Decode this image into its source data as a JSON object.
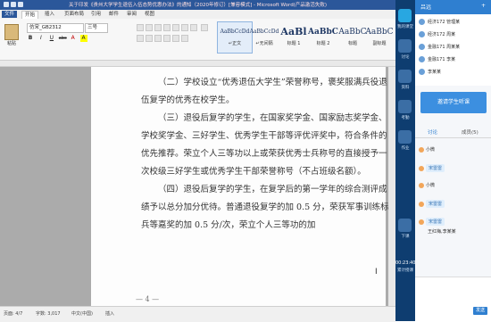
{
  "word": {
    "window_title": "关于印发《贵州大学学生退伍入伍态势优惠办法》的通知（2020年修订）[兼容模式] - Microsoft Word(产品激活失败)",
    "tabs": [
      "文件",
      "开始",
      "插入",
      "页面布局",
      "引用",
      "邮件",
      "审阅",
      "视图"
    ],
    "active_tab": "开始",
    "clipboard": {
      "paste_label": "粘贴"
    },
    "font": {
      "name": "仿宋_GB2312",
      "size": "三号"
    },
    "format_buttons": [
      "B",
      "I",
      "U",
      "abc",
      "A",
      "A"
    ],
    "styles": [
      {
        "sample": "AaBbCcDd",
        "name": "↵正文"
      },
      {
        "sample": "AaBbCcDd",
        "name": "↵无间隔"
      },
      {
        "sample": "AaBl",
        "name": "标题 1"
      },
      {
        "sample": "AaBbC",
        "name": "标题 2"
      },
      {
        "sample": "AaBbC",
        "name": "标题"
      },
      {
        "sample": "AaBbC",
        "name": "副标题"
      }
    ],
    "paragraphs": [
      "（二）学校设立“优秀退伍大学生”荣誉称号，褒奖服满兵役退伍复学的优秀在校学生。",
      "（三）退役后复学的学生，在国家奖学金、国家励志奖学金、学校奖学金、三好学生、优秀学生干部等评优评奖中，符合条件的优先推荐。荣立个人三等功以上或荣获优秀士兵称号的直接授予一次校级三好学生或优秀学生干部荣誉称号（不占班级名额）。",
      "（四）退役后复学的学生，在复学后的第一学年的综合测评成绩予以总分加分优待。普通退役复学的加 0.5 分，荣获军事训练标兵等嘉奖的加 0.5 分/次，荣立个人三等功的加"
    ],
    "page_number": "— 4 —",
    "status": {
      "page": "页面: 4/7",
      "words": "字数: 3,017",
      "lang": "中文(中国)",
      "mode": "插入"
    },
    "cursor_char": "I"
  },
  "dock": {
    "items": [
      {
        "label": "我的课堂",
        "color": "#28a7e1"
      },
      {
        "label": "讨论",
        "color": "#3b6ea5"
      },
      {
        "label": "资料",
        "color": "#3b6ea5"
      },
      {
        "label": "考勤",
        "color": "#3b6ea5"
      },
      {
        "label": "作业",
        "color": "#3b6ea5"
      },
      {
        "label": "下课",
        "color": "#3b6ea5"
      }
    ],
    "timer": "00:23:40",
    "timer_label": "累计授课"
  },
  "side": {
    "header_name": "吕远",
    "header_action": "+",
    "users": [
      "经济172 管理某",
      "经济172 周某",
      "金融171 周某某",
      "金融171 李某",
      "李某某"
    ],
    "invite_button": "邀请学生听课",
    "tabs": [
      "讨论",
      "成员(5)"
    ],
    "active_tab": "讨论",
    "messages": [
      {
        "sender": "小微",
        "text": ""
      },
      {
        "sender": "宋雷雷",
        "text": ""
      },
      {
        "sender": "小微",
        "text": ""
      },
      {
        "sender": "宋雷雷",
        "text": ""
      },
      {
        "sender": "宋雷雷",
        "text": "王红梅,李某某"
      }
    ],
    "send_button": "发送"
  },
  "colors": {
    "word_blue": "#2b579a",
    "dock_blue": "#0e3d70",
    "accent": "#2f7fd0"
  }
}
